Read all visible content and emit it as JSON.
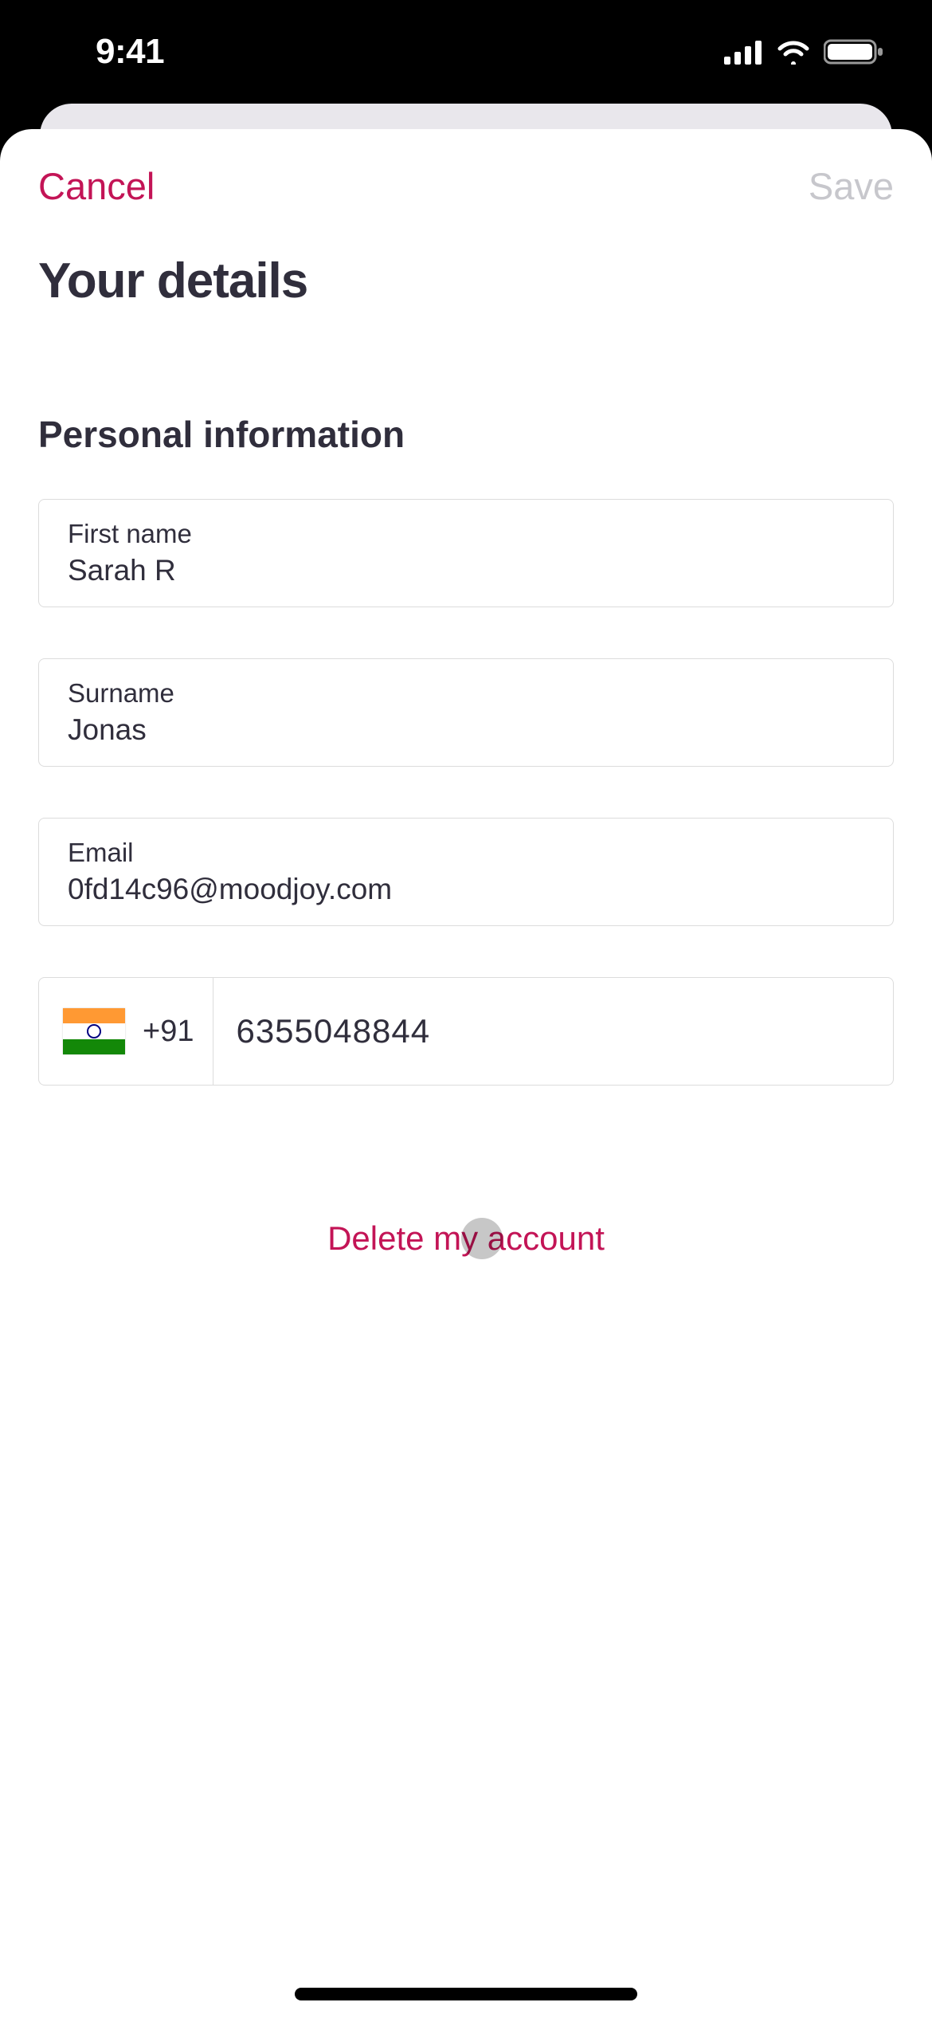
{
  "status": {
    "time": "9:41"
  },
  "nav": {
    "cancel": "Cancel",
    "save": "Save"
  },
  "page": {
    "title": "Your details",
    "sectionHeading": "Personal information"
  },
  "fields": {
    "firstName": {
      "label": "First name",
      "value": "Sarah R"
    },
    "surname": {
      "label": "Surname",
      "value": "Jonas"
    },
    "email": {
      "label": "Email",
      "value": "0fd14c96@moodjoy.com"
    },
    "phone": {
      "countryFlag": "india",
      "dialCode": "+91",
      "number": "6355048844"
    }
  },
  "actions": {
    "deleteAccount": "Delete my account"
  },
  "colors": {
    "destructive": "#c31456",
    "disabled": "#c7c7cc",
    "textPrimary": "#302e3c",
    "border": "#dcdcdc"
  }
}
